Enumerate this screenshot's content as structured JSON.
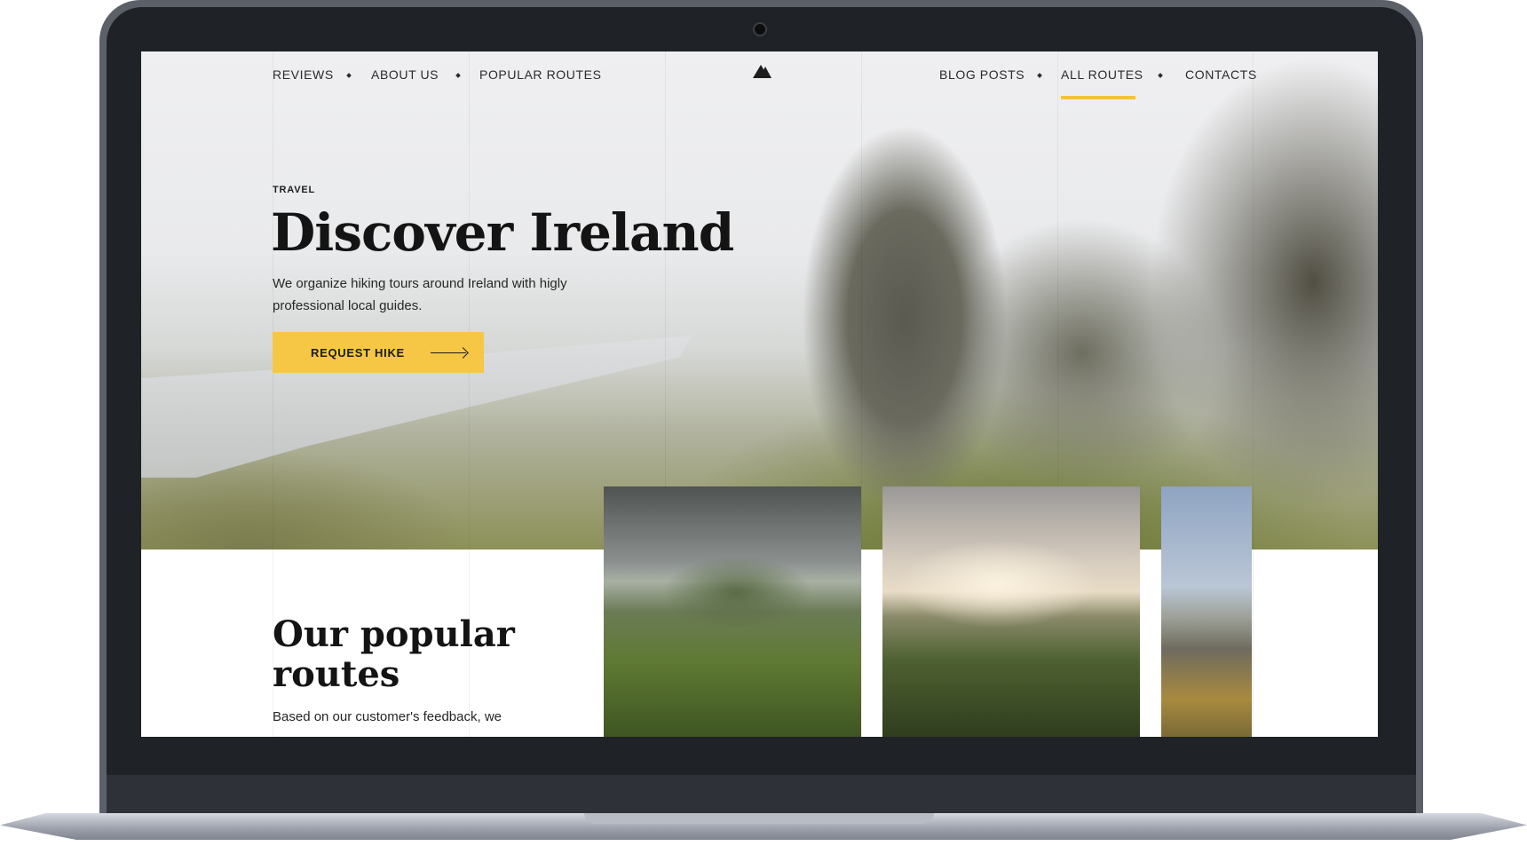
{
  "nav": {
    "left": [
      "REVIEWS",
      "ABOUT US",
      "POPULAR ROUTES"
    ],
    "right": [
      "BLOG POSTS",
      "ALL ROUTES",
      "CONTACTS"
    ],
    "active": "ALL ROUTES",
    "logo_icon": "mountain-logo-icon",
    "accent_color": "#f6c744"
  },
  "hero": {
    "eyebrow": "TRAVEL",
    "title": "Discover Ireland",
    "description": "We organize hiking tours around Ireland with higly professional local guides.",
    "cta_label": "REQUEST HIKE",
    "cta_icon": "arrow-right-icon"
  },
  "routes_section": {
    "title": "Our popular routes",
    "text": "Based on our customer's feedback, we"
  }
}
